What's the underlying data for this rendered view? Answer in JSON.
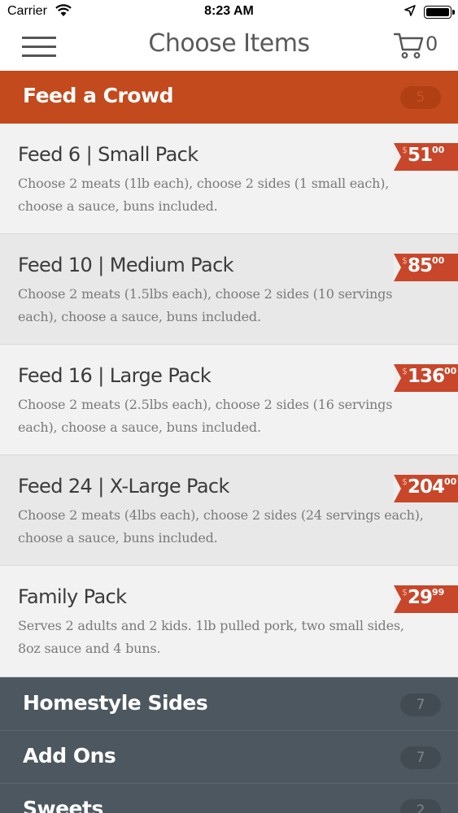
{
  "status_bar": {
    "carrier": "Carrier",
    "time": "8:23 AM"
  },
  "nav": {
    "title": "Choose Items",
    "cart_count": "0"
  },
  "colors": {
    "accent_orange": "#c24a1c",
    "price_tag": "#c8462a",
    "dark_section": "#4d575f"
  },
  "sections": [
    {
      "label": "Feed a Crowd",
      "count": "5"
    },
    {
      "label": "Homestyle Sides",
      "count": "7"
    },
    {
      "label": "Add Ons",
      "count": "7"
    },
    {
      "label": "Sweets",
      "count": "2"
    }
  ],
  "items": [
    {
      "name": "Feed 6 | Small Pack",
      "desc": "Choose 2 meats (1lb each), choose 2 sides (1 small each), choose a sauce, buns included.",
      "currency": "$",
      "price_whole": "51",
      "price_cents": "00"
    },
    {
      "name": "Feed 10 | Medium Pack",
      "desc": "Choose 2 meats (1.5lbs each), choose 2 sides (10 servings each), choose a sauce, buns included.",
      "currency": "$",
      "price_whole": "85",
      "price_cents": "00"
    },
    {
      "name": "Feed 16 | Large Pack",
      "desc": "Choose 2 meats (2.5lbs each), choose 2 sides (16 servings each), choose a sauce, buns included.",
      "currency": "$",
      "price_whole": "136",
      "price_cents": "00"
    },
    {
      "name": "Feed 24 | X-Large Pack",
      "desc": "Choose 2 meats (4lbs each), choose 2 sides (24 servings each), choose a sauce, buns included.",
      "currency": "$",
      "price_whole": "204",
      "price_cents": "00"
    },
    {
      "name": "Family Pack",
      "desc": "Serves 2 adults and 2 kids. 1lb pulled pork, two small sides, 8oz sauce and 4 buns.",
      "currency": "$",
      "price_whole": "29",
      "price_cents": "99"
    }
  ]
}
